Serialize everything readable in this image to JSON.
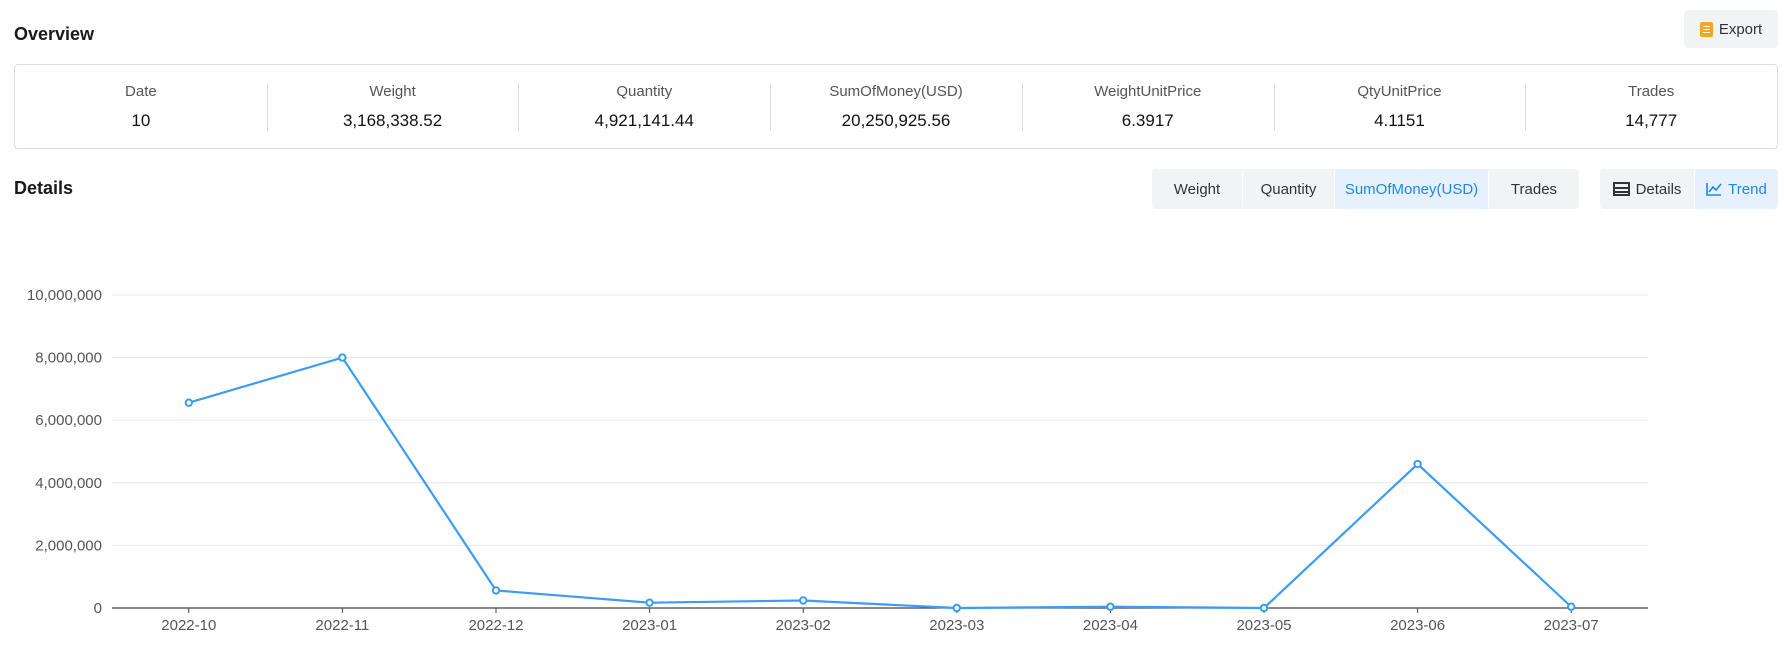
{
  "overview": {
    "title": "Overview",
    "export_label": "Export",
    "metrics": [
      {
        "label": "Date",
        "value": "10"
      },
      {
        "label": "Weight",
        "value": "3,168,338.52"
      },
      {
        "label": "Quantity",
        "value": "4,921,141.44"
      },
      {
        "label": "SumOfMoney(USD)",
        "value": "20,250,925.56"
      },
      {
        "label": "WeightUnitPrice",
        "value": "6.3917"
      },
      {
        "label": "QtyUnitPrice",
        "value": "4.1151"
      },
      {
        "label": "Trades",
        "value": "14,777"
      }
    ]
  },
  "details": {
    "title": "Details",
    "metric_tabs": [
      "Weight",
      "Quantity",
      "SumOfMoney(USD)",
      "Trades"
    ],
    "active_metric": "SumOfMoney(USD)",
    "view_tabs": [
      "Details",
      "Trend"
    ],
    "active_view": "Trend"
  },
  "colors": {
    "accent": "#1e88e5",
    "line": "#3b9cf5",
    "active_tab_bg": "#e6f1fd"
  },
  "chart_data": {
    "type": "line",
    "categories": [
      "2022-10",
      "2022-11",
      "2022-12",
      "2023-01",
      "2023-02",
      "2023-03",
      "2023-04",
      "2023-05",
      "2023-06",
      "2023-07"
    ],
    "series": [
      {
        "values": [
          6560000,
          8000000,
          560000,
          170000,
          240000,
          0,
          40000,
          0,
          4600000,
          40000
        ]
      }
    ],
    "y_ticks": [
      "0",
      "2,000,000",
      "4,000,000",
      "6,000,000",
      "8,000,000",
      "10,000,000"
    ],
    "ylim": [
      0,
      10000000
    ],
    "grid": true
  }
}
